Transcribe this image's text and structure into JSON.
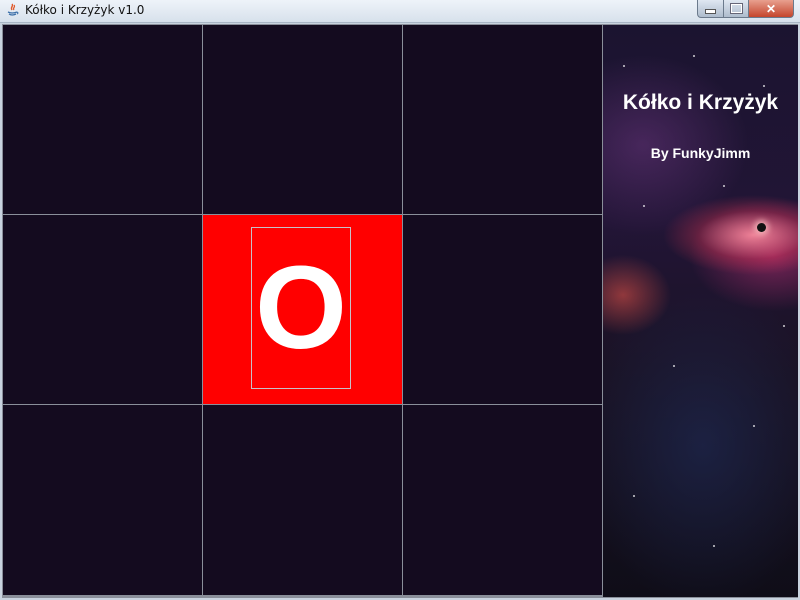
{
  "window": {
    "title": "Kółko i Krzyżyk v1.0",
    "controls": {
      "minimize": "–",
      "maximize": "□",
      "close": "✕"
    }
  },
  "board": {
    "cells": [
      "",
      "",
      "",
      "",
      "O",
      "",
      "",
      "",
      ""
    ],
    "active_cell": 4,
    "colors": {
      "cell_bg": "#140b1f",
      "active_bg": "#ff0000",
      "grid": "#8a8f9a",
      "mark": "#ffffff"
    }
  },
  "sidebar": {
    "title": "Kółko i Krzyżyk",
    "author": "By FunkyJimm"
  }
}
